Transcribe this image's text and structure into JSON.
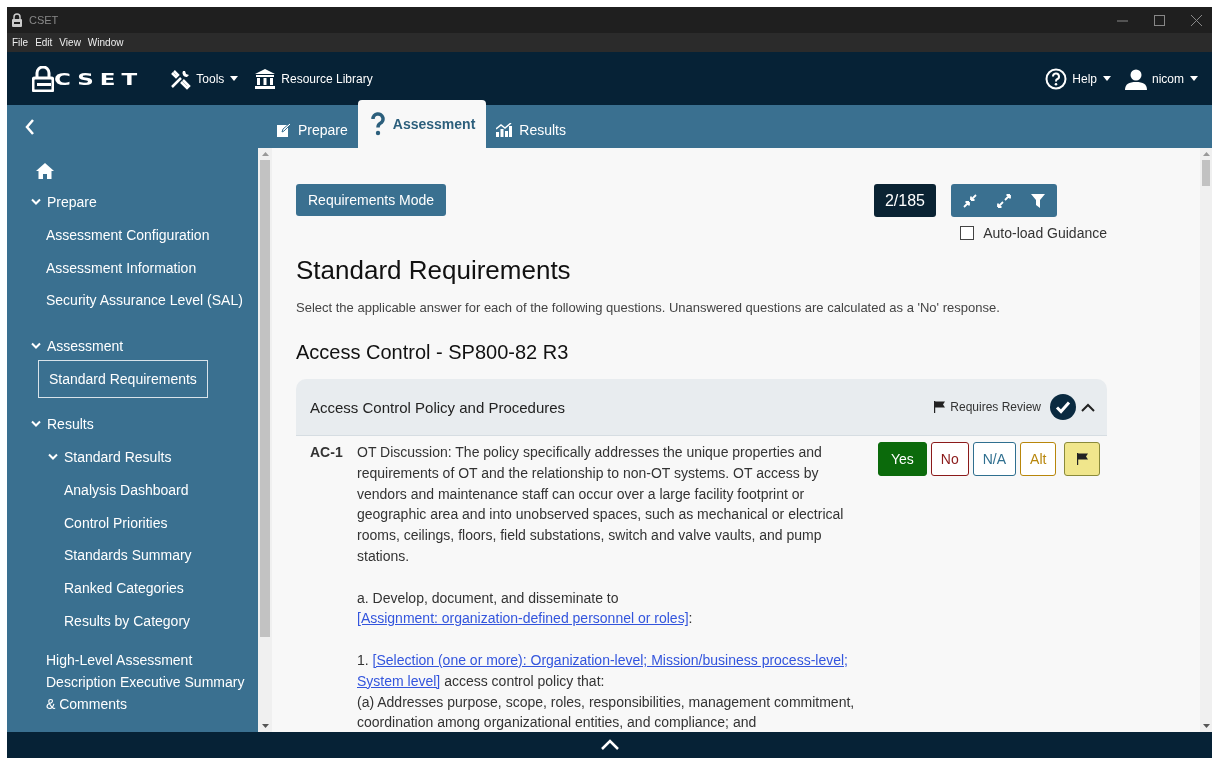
{
  "window": {
    "title": "CSET"
  },
  "menu": [
    "File",
    "Edit",
    "View",
    "Window"
  ],
  "header": {
    "logo": "CSET",
    "nav": [
      {
        "label": "Tools",
        "dropdown": true
      },
      {
        "label": "Resource Library"
      }
    ],
    "right": [
      {
        "label": "Help",
        "dropdown": true
      },
      {
        "label": "nicom",
        "dropdown": true
      }
    ]
  },
  "tabs": [
    {
      "label": "Prepare",
      "selected": false
    },
    {
      "label": "Assessment",
      "selected": true
    },
    {
      "label": "Results",
      "selected": false
    }
  ],
  "sidebar": {
    "items": [
      {
        "label": "Prepare",
        "expanded": true,
        "selected": false,
        "children": [
          {
            "label": "Assessment Configuration",
            "selected": false
          },
          {
            "label": "Assessment Information",
            "selected": false
          },
          {
            "label": "Security Assurance Level (SAL)",
            "selected": false
          }
        ]
      },
      {
        "label": "Assessment",
        "expanded": true,
        "selected": false,
        "children": [
          {
            "label": "Standard Requirements",
            "selected": true
          }
        ]
      },
      {
        "label": "Results",
        "expanded": true,
        "selected": false,
        "children": [
          {
            "label": "Standard Results",
            "expanded": true,
            "selected": false,
            "children": [
              {
                "label": "Analysis Dashboard",
                "selected": false
              },
              {
                "label": "Control Priorities",
                "selected": false
              },
              {
                "label": "Standards Summary",
                "selected": false
              },
              {
                "label": "Ranked Categories",
                "selected": false
              },
              {
                "label": "Results by Category",
                "selected": false
              }
            ]
          },
          {
            "label": "High-Level Assessment Description Executive Summary & Comments",
            "selected": false
          }
        ]
      }
    ]
  },
  "toolbar": {
    "mode_button": "Requirements Mode",
    "counter": "2/185",
    "auto_load": {
      "label": "Auto-load Guidance",
      "checked": false
    }
  },
  "title": "Standard Requirements",
  "instructions": "Select the applicable answer for each of the following questions. Unanswered questions are calculated as a 'No' response.",
  "section": "Access Control - SP800-82 R3",
  "category": {
    "title": "Access Control Policy and Procedures",
    "review_label": "Requires Review",
    "complete": true,
    "expanded": true
  },
  "question": {
    "id": "AC-1",
    "paragraphs": [
      {
        "segments": [
          {
            "text": "OT Discussion: The policy specifically addresses the unique properties and requirements of OT and the relationship to non-OT systems. OT access by vendors and maintenance staff can occur over a large facility footprint or geographic area and into unobserved spaces, such as mechanical or electrical rooms, ceilings, floors, field substations, switch and valve vaults, and pump stations."
          }
        ]
      },
      {
        "spaced": true,
        "segments": [
          {
            "text": "a. Develop, document, and disseminate to "
          },
          {
            "text": "[Assignment: organization-defined personnel or roles]",
            "link": true
          },
          {
            "text": ":"
          }
        ]
      },
      {
        "spaced": true,
        "segments": [
          {
            "text": "1. "
          },
          {
            "text": "[Selection (one or more): Organization-level; Mission/business process-level;",
            "link": true
          },
          {
            "text": "System level]",
            "link": true
          },
          {
            "text": " access control policy that:"
          }
        ]
      },
      {
        "segments": [
          {
            "text": "(a) Addresses purpose, scope, roles, responsibilities, management commitment, coordination among organizational entities, and compliance; and"
          }
        ]
      }
    ],
    "answers": [
      {
        "label": "Yes",
        "selected": true,
        "color": "#0b6a0b"
      },
      {
        "label": "No",
        "selected": false,
        "color": "#8b1a1a"
      },
      {
        "label": "N/A",
        "selected": false,
        "color": "#2f6f8f"
      },
      {
        "label": "Alt",
        "selected": false,
        "color": "#b8860b"
      }
    ],
    "flagged": true
  }
}
